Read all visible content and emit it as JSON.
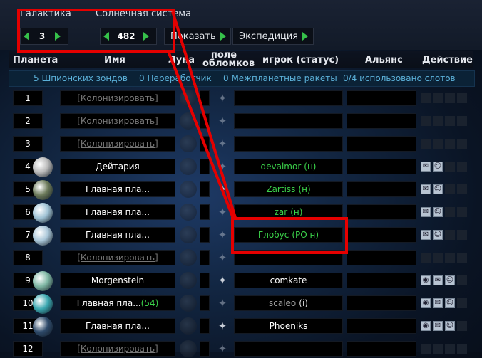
{
  "tabs": [
    "Галактика",
    "Солнечная система"
  ],
  "nav": {
    "galaxy": "3",
    "system": "482"
  },
  "buttons": {
    "show": "Показать",
    "expedition": "Экспедиция"
  },
  "headers": {
    "planet": "Планета",
    "name": "Имя",
    "moon": "Луна",
    "debris": "поле обломков",
    "player": "игрок (статус)",
    "alliance": "Альянс",
    "action": "Действие"
  },
  "info": {
    "probes": "5 Шпионских зондов",
    "recyclers": "0 Переработчик",
    "missiles": "0 Межпланетные ракеты",
    "slots": "0/4 использовано слотов"
  },
  "rows": [
    {
      "pos": "1",
      "name": "[Колонизировать]",
      "player": "",
      "colonize": true
    },
    {
      "pos": "2",
      "name": "[Колонизировать]",
      "player": "",
      "colonize": true
    },
    {
      "pos": "3",
      "name": "[Колонизировать]",
      "player": "",
      "colonize": true
    },
    {
      "pos": "4",
      "name": "Дейтария",
      "player": "devalmor",
      "status": "(н)",
      "playerColor": "green",
      "planet": "#b8b8b8"
    },
    {
      "pos": "5",
      "name": "Главная пла...",
      "player": "Zartiss",
      "status": "(н)",
      "playerColor": "green",
      "planet": "#6c7a5a"
    },
    {
      "pos": "6",
      "name": "Главная пла...",
      "player": "zar",
      "status": "(н)",
      "playerColor": "green",
      "planet": "#9fc2d4"
    },
    {
      "pos": "7",
      "name": "Главная пла...",
      "player": "Глобус",
      "status": "(PO н)",
      "playerColor": "green",
      "planet": "#a9c6d8"
    },
    {
      "pos": "8",
      "name": "[Колонизировать]",
      "player": "",
      "colonize": true
    },
    {
      "pos": "9",
      "name": "Morgenstein",
      "player": "comkate",
      "status": "",
      "playerColor": "white",
      "planet": "#7fb7a4"
    },
    {
      "pos": "10",
      "name": "Главная пла...",
      "nameExtra": "(54)",
      "player": "scaleo",
      "status": "(i)",
      "playerColor": "gray",
      "planet": "#3aa7b0"
    },
    {
      "pos": "11",
      "name": "Главная пла...",
      "player": "Phoeniks",
      "status": "",
      "playerColor": "white",
      "planet": "#2e4a6a"
    },
    {
      "pos": "12",
      "name": "[Колонизировать]",
      "player": "",
      "colonize": true
    }
  ],
  "colors": {
    "annotation": "#e50000",
    "accent_green": "#36c14a",
    "info_blue": "#5bb0d8"
  }
}
